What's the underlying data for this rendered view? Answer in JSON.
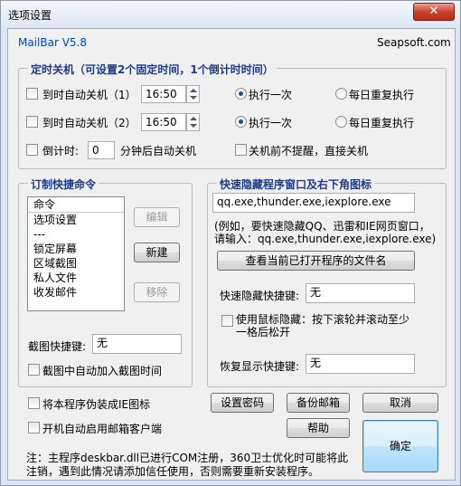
{
  "window": {
    "title": "选项设置",
    "close_glyph": "✕"
  },
  "header": {
    "app_version": "MailBar V5.8",
    "vendor": "Seapsoft.com"
  },
  "shutdown": {
    "legend": "定时关机（可设置2个固定时间，1个倒计时时间）",
    "timer1_label": "到时自动关机（1）",
    "timer1_time": "16:50",
    "timer2_label": "到时自动关机（2）",
    "timer2_time": "16:50",
    "once_label": "执行一次",
    "daily_label": "每日重复执行",
    "countdown_label": "倒计时:",
    "countdown_value": "0",
    "countdown_suffix": "分钟后自动关机",
    "no_prompt_label": "关机前不提醒，直接关机"
  },
  "commands": {
    "legend": "订制快捷命令",
    "list_header": "命令",
    "items": [
      "选项设置",
      "---",
      "锁定屏幕",
      "区域截图",
      "私人文件",
      "收发邮件"
    ],
    "edit_button": "编辑",
    "new_button": "新建",
    "remove_button": "移除",
    "screenshot_hotkey_label": "截图快捷键:",
    "screenshot_hotkey_value": "无",
    "auto_time_label": "截图中自动加入截图时间"
  },
  "hide": {
    "legend": "快速隐藏程序窗口及右下角图标",
    "program_list_value": "qq.exe,thunder.exe,iexplore.exe",
    "hint_line1": "(例如，要快速隐藏QQ、迅雷和IE网页窗口，",
    "hint_line2": "请输入：qq.exe,thunder.exe,iexplore.exe)",
    "view_button": "查看当前已打开程序的文件名",
    "hide_hotkey_label": "快速隐藏快捷键:",
    "hide_hotkey_value": "无",
    "mouse_hide_line1": "使用鼠标隐藏：按下滚轮并滚动至少",
    "mouse_hide_line2": "一格后松开",
    "restore_hotkey_label": "恢复显示快捷键:",
    "restore_hotkey_value": "无"
  },
  "bottom": {
    "disguise_ie_label": "将本程序伪装成IE图标",
    "autostart_label": "开机自动启用邮箱客户端",
    "set_password_button": "设置密码",
    "backup_mail_button": "备份邮箱",
    "cancel_button": "取消",
    "help_button": "帮助",
    "ok_button": "确定",
    "note_line1": "注：主程序deskbar.dll已进行COM注册，360卫士优化时可能将此",
    "note_line2": "注销，遇到此情况请添加信任使用，否则需要重新安装程序。"
  }
}
